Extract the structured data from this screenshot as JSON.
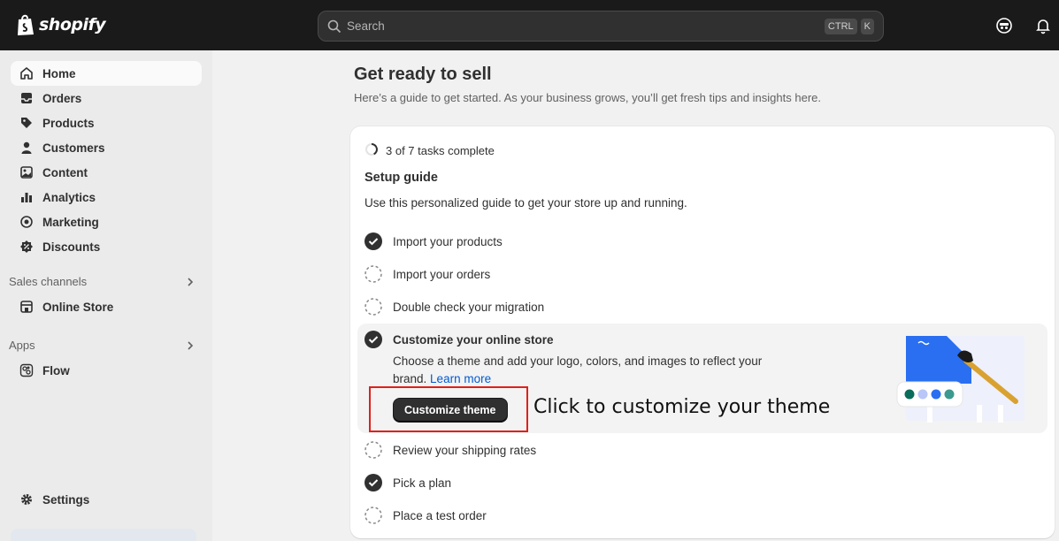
{
  "topbar": {
    "brand": "shopify",
    "search_placeholder": "Search",
    "shortcut_keys": [
      "CTRL",
      "K"
    ]
  },
  "sidebar": {
    "items": [
      {
        "label": "Home",
        "icon": "home-icon",
        "active": true
      },
      {
        "label": "Orders",
        "icon": "inbox-icon"
      },
      {
        "label": "Products",
        "icon": "tag-icon"
      },
      {
        "label": "Customers",
        "icon": "person-icon"
      },
      {
        "label": "Content",
        "icon": "image-icon"
      },
      {
        "label": "Analytics",
        "icon": "bar-chart-icon"
      },
      {
        "label": "Marketing",
        "icon": "target-icon"
      },
      {
        "label": "Discounts",
        "icon": "discount-icon"
      }
    ],
    "sales_channels_label": "Sales channels",
    "online_store_label": "Online Store",
    "apps_label": "Apps",
    "flow_label": "Flow",
    "settings_label": "Settings"
  },
  "main": {
    "title": "Get ready to sell",
    "subtitle": "Here’s a guide to get started. As your business grows, you’ll get fresh tips and insights here."
  },
  "guide": {
    "progress_text": "3 of 7 tasks complete",
    "progress_fraction": 0.4286,
    "title": "Setup guide",
    "description": "Use this personalized guide to get your store up and running.",
    "tasks": [
      {
        "label": "Import your products",
        "done": true
      },
      {
        "label": "Import your orders",
        "done": false
      },
      {
        "label": "Double check your migration",
        "done": false
      },
      {
        "label": "Customize your online store",
        "done": true,
        "expanded": true
      },
      {
        "label": "Review your shipping rates",
        "done": false
      },
      {
        "label": "Pick a plan",
        "done": true
      },
      {
        "label": "Place a test order",
        "done": false
      }
    ],
    "expanded_body": "Choose a theme and add your logo, colors, and images to reflect your brand.",
    "learn_more": "Learn more",
    "cta_label": "Customize theme"
  },
  "annotation": {
    "text": "Click to customize your theme",
    "color": "#e0201b"
  },
  "colors": {
    "topbar": "#1a1a1a",
    "link": "#005bd3",
    "primary_button": "#303030"
  }
}
